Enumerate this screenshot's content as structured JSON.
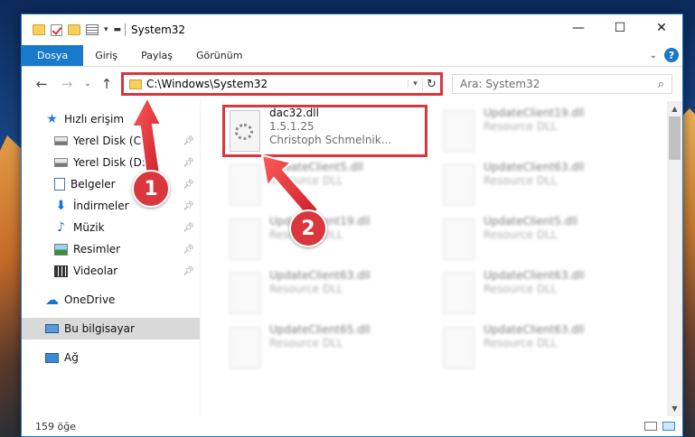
{
  "window": {
    "title": "System32",
    "controls": {
      "minimize": "—",
      "maximize": "☐",
      "close": "✕"
    }
  },
  "ribbon": {
    "tabs": [
      "Dosya",
      "Giriş",
      "Paylaş",
      "Görünüm"
    ],
    "help": "?"
  },
  "nav": {
    "back": "←",
    "forward": "→",
    "recent": "⌄",
    "up": "↑",
    "address": "C:\\Windows\\System32",
    "refresh": "↻",
    "search_placeholder": "Ara: System32"
  },
  "sidebar": {
    "items": [
      {
        "label": "Hızlı erişim",
        "icon": "star-icon",
        "pinned": false
      },
      {
        "label": "Yerel Disk (C:)",
        "icon": "disk-icon",
        "pinned": true
      },
      {
        "label": "Yerel Disk (D:)",
        "icon": "disk-icon",
        "pinned": true
      },
      {
        "label": "Belgeler",
        "icon": "document-icon",
        "pinned": true
      },
      {
        "label": "İndirmeler",
        "icon": "download-icon",
        "pinned": true
      },
      {
        "label": "Müzik",
        "icon": "music-icon",
        "pinned": true
      },
      {
        "label": "Resimler",
        "icon": "pictures-icon",
        "pinned": true
      },
      {
        "label": "Videolar",
        "icon": "video-icon",
        "pinned": true
      },
      {
        "label": "OneDrive",
        "icon": "onedrive-icon",
        "pinned": false
      },
      {
        "label": "Bu bilgisayar",
        "icon": "this-pc-icon",
        "pinned": false
      },
      {
        "label": "Ağ",
        "icon": "network-icon",
        "pinned": false
      }
    ]
  },
  "files": [
    {
      "name": "dac32.dll",
      "line2": "1.5.1.25",
      "line3": "Christoph Schmelnik..."
    },
    {
      "name": "UpdateClient19.dll",
      "line2": "Resource DLL"
    },
    {
      "name": "UpdateClient5.dll",
      "line2": "Resource DLL"
    },
    {
      "name": "UpdateClient63.dll",
      "line2": "Resource DLL"
    },
    {
      "name": "UpdateClient19.dll",
      "line2": "Resource DLL"
    },
    {
      "name": "UpdateClient5.dll",
      "line2": "Resource DLL"
    },
    {
      "name": "UpdateClient63.dll",
      "line2": "Resource DLL"
    },
    {
      "name": "UpdateClient63.dll",
      "line2": "Resource DLL"
    },
    {
      "name": "UpdateClient65.dll",
      "line2": "Resource DLL"
    },
    {
      "name": "UpdateClient63.dll",
      "line2": "Resource DLL"
    }
  ],
  "status": {
    "count": "159 öğe"
  },
  "callouts": {
    "one": "1",
    "two": "2"
  },
  "colors": {
    "accent": "#1979ca",
    "highlight": "#d9363e"
  }
}
